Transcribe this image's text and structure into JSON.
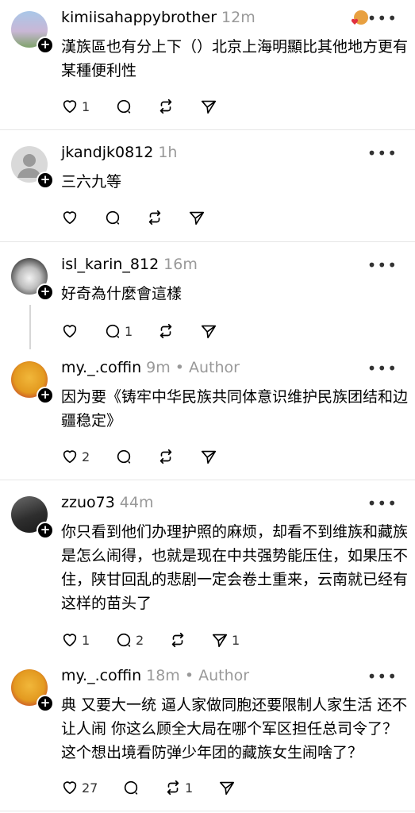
{
  "posts": [
    {
      "username": "kimiisahappybrother",
      "time": "12m",
      "author": "",
      "text": "漢族區也有分上下（）北京上海明顯比其他地方更有某種便利性",
      "likes": "1",
      "comments": "",
      "reposts": "",
      "shares": ""
    },
    {
      "username": "jkandjk0812",
      "time": "1h",
      "author": "",
      "text": "三六九等",
      "likes": "",
      "comments": "",
      "reposts": "",
      "shares": ""
    },
    {
      "username": "isl_karin_812",
      "time": "16m",
      "author": "",
      "text": "好奇為什麼會這樣",
      "likes": "",
      "comments": "1",
      "reposts": "",
      "shares": ""
    },
    {
      "username": "my._.coffin",
      "time": "9m",
      "author": "• Author",
      "text": "因为要《铸牢中华民族共同体意识维护民族团结和边疆稳定》",
      "likes": "2",
      "comments": "",
      "reposts": "",
      "shares": ""
    },
    {
      "username": "zzuo73",
      "time": "44m",
      "author": "",
      "text": "你只看到他们办理护照的麻烦，却看不到维族和藏族是怎么闹得，也就是现在中共强势能压住，如果压不住，陕甘回乱的悲剧一定会卷土重来，云南就已经有这样的苗头了",
      "likes": "1",
      "comments": "2",
      "reposts": "",
      "shares": "1"
    },
    {
      "username": "my._.coffin",
      "time": "18m",
      "author": "• Author",
      "text": "典 又要大一统 逼人家做同胞还要限制人家生活 还不让人闹 你这么顾全大局在哪个军区担任总司令了？这个想出境看防弹少年团的藏族女生闹啥了？",
      "likes": "27",
      "comments": "",
      "reposts": "1",
      "shares": ""
    }
  ],
  "icons": {
    "like": "heart-icon",
    "comment": "comment-icon",
    "repost": "repost-icon",
    "share": "share-icon",
    "more": "more-icon"
  }
}
